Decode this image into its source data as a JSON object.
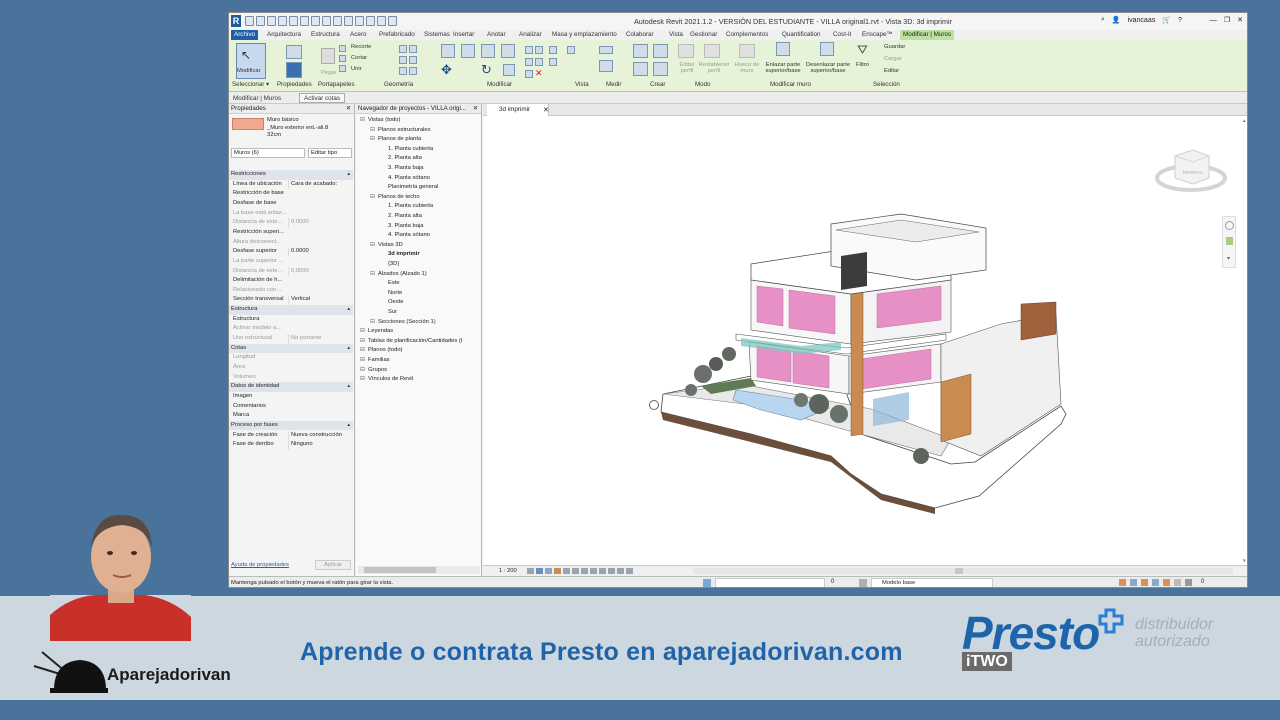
{
  "window": {
    "title": "Autodesk Revit 2021.1.2 - VERSIÓN DEL ESTUDIANTE - VILLA original1.rvt - Vista 3D: 3d imprimir",
    "user": "ivancaas"
  },
  "ribbon": {
    "tabs": [
      "Archivo",
      "Arquitectura",
      "Estructura",
      "Acero",
      "Prefabricado",
      "Sistemas",
      "Insertar",
      "Anotar",
      "Analizar",
      "Masa y emplazamiento",
      "Colaborar",
      "Vista",
      "Gestionar",
      "Complementos",
      "Quantification",
      "Cost-it",
      "Enscape™",
      "Modificar | Muros"
    ],
    "buttons": {
      "modificar": "Modificar",
      "recortar": "Recorte",
      "cortar": "Cortar",
      "unir": "Unir",
      "pegar": "Pegar",
      "editar_perfil": "Editar perfil",
      "restablecer_perfil": "Restablecer perfil",
      "hueco_muro": "Hueco de muro",
      "enlazar": "Enlazar parte superior/base",
      "desenlazar": "Desenlazar parte superior/base",
      "filtro": "Filtro",
      "guardar": "Guardar",
      "cargar": "Cargar",
      "editar": "Editar"
    },
    "groups": [
      "Seleccionar ▾",
      "Propiedades",
      "Portapapeles",
      "Geometría",
      "Modificar",
      "Vista",
      "Medir",
      "Crear",
      "Modo",
      "Modificar muro",
      "Selección"
    ]
  },
  "option_bar": {
    "context": "Modificar | Muros",
    "button": "Activar cotas"
  },
  "properties": {
    "title": "Propiedades",
    "type_line1": "Muro básico",
    "type_line2": "_Muro exterior enL-ali.8",
    "type_line3": "32cm",
    "selector": "Muros (6)",
    "edit_type": "Editar tipo",
    "help_link": "Ayuda de propiedades",
    "apply": "Aplicar",
    "rows": [
      {
        "label": "Restricciones",
        "value": "",
        "kind": "sec"
      },
      {
        "label": "Línea de ubicación",
        "value": "Cara de acabado:",
        "kind": "row"
      },
      {
        "label": "Restricción de base",
        "value": "",
        "kind": "row"
      },
      {
        "label": "Desfase de base",
        "value": "",
        "kind": "row"
      },
      {
        "label": "La base está enlaz...",
        "value": "",
        "kind": "dim"
      },
      {
        "label": "Distancia de exte...",
        "value": "0.0000",
        "kind": "dim"
      },
      {
        "label": "Restricción superi...",
        "value": "",
        "kind": "row"
      },
      {
        "label": "Altura desconect...",
        "value": "",
        "kind": "dim"
      },
      {
        "label": "Desfase superior",
        "value": "0.0000",
        "kind": "row"
      },
      {
        "label": "La parte superior ...",
        "value": "",
        "kind": "dim"
      },
      {
        "label": "Distancia de exte...",
        "value": "0.0000",
        "kind": "dim"
      },
      {
        "label": "Delimitación de h...",
        "value": "",
        "kind": "row"
      },
      {
        "label": "Relacionado con ...",
        "value": "",
        "kind": "dim"
      },
      {
        "label": "Sección transversal",
        "value": "Vertical",
        "kind": "row"
      },
      {
        "label": "Estructura",
        "value": "",
        "kind": "sec"
      },
      {
        "label": "Estructura",
        "value": "",
        "kind": "row"
      },
      {
        "label": "Activar modelo a...",
        "value": "",
        "kind": "dim"
      },
      {
        "label": "Uso estructural",
        "value": "No portante",
        "kind": "dim"
      },
      {
        "label": "Cotas",
        "value": "",
        "kind": "sec"
      },
      {
        "label": "Longitud",
        "value": "",
        "kind": "dim"
      },
      {
        "label": "Área",
        "value": "",
        "kind": "dim"
      },
      {
        "label": "Volumen",
        "value": "",
        "kind": "dim"
      },
      {
        "label": "Datos de identidad",
        "value": "",
        "kind": "sec"
      },
      {
        "label": "Imagen",
        "value": "",
        "kind": "row"
      },
      {
        "label": "Comentarios",
        "value": "",
        "kind": "row"
      },
      {
        "label": "Marca",
        "value": "",
        "kind": "row"
      },
      {
        "label": "Proceso por fases",
        "value": "",
        "kind": "sec"
      },
      {
        "label": "Fase de creación",
        "value": "Nueva construcción",
        "kind": "row"
      },
      {
        "label": "Fase de derribo",
        "value": "Ninguno",
        "kind": "row"
      }
    ]
  },
  "browser": {
    "title": "Navegador de proyectos - VILLA origi...",
    "items": [
      {
        "label": "Vistas (todo)",
        "indent": 0,
        "bold": false
      },
      {
        "label": "Planos estructurales",
        "indent": 1,
        "bold": false
      },
      {
        "label": "Planos de planta",
        "indent": 1,
        "bold": false
      },
      {
        "label": "1. Planta cubierta",
        "indent": 2,
        "bold": false
      },
      {
        "label": "2. Planta alta",
        "indent": 2,
        "bold": false
      },
      {
        "label": "3. Planta baja",
        "indent": 2,
        "bold": false
      },
      {
        "label": "4. Planta sótano",
        "indent": 2,
        "bold": false
      },
      {
        "label": "Planimetría general",
        "indent": 2,
        "bold": false
      },
      {
        "label": "Planos de techo",
        "indent": 1,
        "bold": false
      },
      {
        "label": "1. Planta cubierta",
        "indent": 2,
        "bold": false
      },
      {
        "label": "2. Planta alta",
        "indent": 2,
        "bold": false
      },
      {
        "label": "3. Planta baja",
        "indent": 2,
        "bold": false
      },
      {
        "label": "4. Planta sótano",
        "indent": 2,
        "bold": false
      },
      {
        "label": "Vistas 3D",
        "indent": 1,
        "bold": false
      },
      {
        "label": "3d imprimir",
        "indent": 2,
        "bold": true
      },
      {
        "label": "{3D}",
        "indent": 2,
        "bold": false
      },
      {
        "label": "Alzados (Alzado 1)",
        "indent": 1,
        "bold": false
      },
      {
        "label": "Este",
        "indent": 2,
        "bold": false
      },
      {
        "label": "Norte",
        "indent": 2,
        "bold": false
      },
      {
        "label": "Oeste",
        "indent": 2,
        "bold": false
      },
      {
        "label": "Sur",
        "indent": 2,
        "bold": false
      },
      {
        "label": "Secciones (Sección 1)",
        "indent": 1,
        "bold": false
      },
      {
        "label": "Leyendas",
        "indent": 0,
        "bold": false
      },
      {
        "label": "Tablas de planificación/Cantidades (t",
        "indent": 0,
        "bold": false
      },
      {
        "label": "Planos (todo)",
        "indent": 0,
        "bold": false
      },
      {
        "label": "Familias",
        "indent": 0,
        "bold": false
      },
      {
        "label": "Grupos",
        "indent": 0,
        "bold": false
      },
      {
        "label": "Vínculos de Revit",
        "indent": 0,
        "bold": false
      }
    ]
  },
  "viewport": {
    "tab": "3d imprimir",
    "scale": "1 : 200",
    "viewcube": "FRONTAL"
  },
  "status": {
    "hint": "Mantenga pulsado el botón y mueva el ratón para girar la vista.",
    "model": "Modelo base",
    "filter_count": "0",
    "sel_count": "0"
  },
  "overlay": {
    "slogan": "Aprende o contrata Presto en aparejadorivan.com",
    "brand": "Aparejadorivan",
    "presto": "Presto",
    "itwo": "iTWO",
    "dist1": "distribuidor",
    "dist2": "autorizado"
  },
  "colors": {
    "accent": "#1e5fa8",
    "ribbon_ctx": "#e6f3d8",
    "slogan": "#1f63a8",
    "glass": "#e58fc8"
  }
}
